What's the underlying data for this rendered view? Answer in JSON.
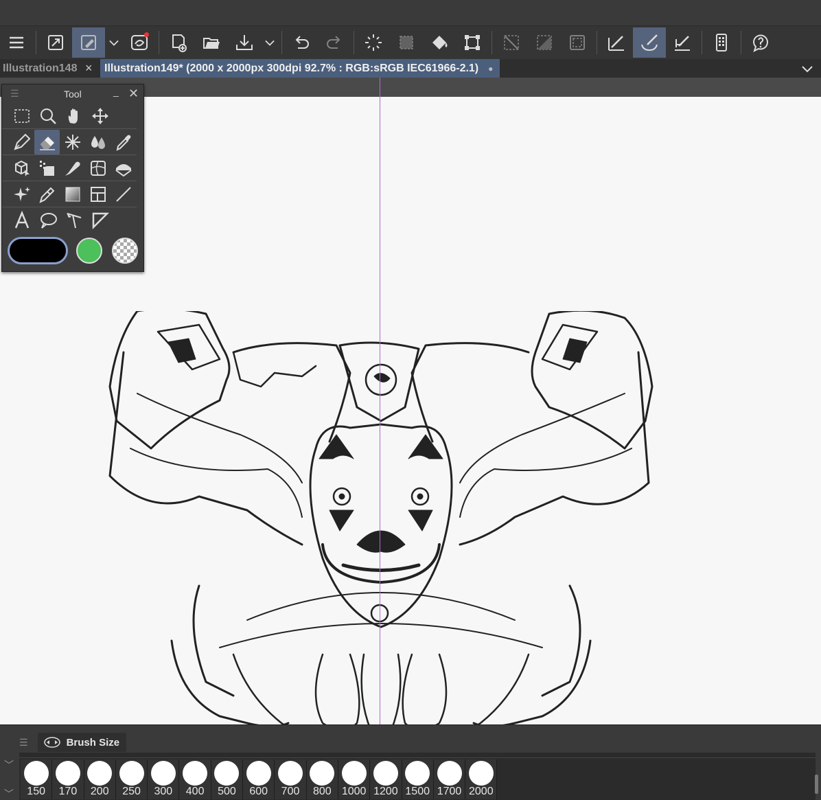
{
  "toolbar": {
    "items": [
      {
        "name": "menu-icon"
      },
      {
        "name": "fit-canvas-icon"
      },
      {
        "name": "quick-access-icon",
        "active": true
      },
      {
        "name": "dropdown-icon"
      },
      {
        "name": "companion-icon"
      },
      {
        "name": "new-file-icon"
      },
      {
        "name": "open-file-icon"
      },
      {
        "name": "save-icon"
      },
      {
        "name": "save-dropdown-icon"
      },
      {
        "name": "undo-icon"
      },
      {
        "name": "redo-icon"
      },
      {
        "name": "loading-icon"
      },
      {
        "name": "selection-launcher-icon"
      },
      {
        "name": "fill-icon"
      },
      {
        "name": "transform-icon"
      },
      {
        "name": "clear-selection-icon"
      },
      {
        "name": "invert-selection-icon"
      },
      {
        "name": "selection-border-icon"
      },
      {
        "name": "pen-icon"
      },
      {
        "name": "brush-icon",
        "active": true
      },
      {
        "name": "pencil-icon"
      },
      {
        "name": "smartphone-icon"
      },
      {
        "name": "help-icon"
      }
    ]
  },
  "tabs": [
    {
      "title": "Illustration148",
      "close": "×",
      "active": false
    },
    {
      "title": "Illustration149* (2000 x 2000px 300dpi 92.7% : RGB:sRGB IEC61966-2.1)",
      "mod": "●",
      "active": true
    }
  ],
  "tool_palette": {
    "title": "Tool",
    "minimize": "_",
    "close": "✕",
    "rows": [
      [
        "selection-tool",
        "zoom-tool",
        "hand-tool",
        "move-tool"
      ],
      [
        "pen-tool",
        "eraser-tool",
        "decoration-tool",
        "blend-tool",
        "eyedropper-tool"
      ],
      [
        "3d-operation-tool",
        "figure-tool",
        "airbrush-tool",
        "ruler-tool",
        "fill-tool"
      ],
      [
        "sparkle-tool",
        "brush-tool",
        "gradient-tool",
        "frame-border-tool",
        "line-tool"
      ],
      [
        "text-tool",
        "balloon-tool",
        "correct-line-tool",
        "figure-ruler-tool"
      ]
    ],
    "active_tool": "eraser-tool",
    "main_color": "#000000",
    "sub_color": "#4cc05a"
  },
  "brush_size": {
    "title": "Brush Size",
    "sizes": [
      "150",
      "170",
      "200",
      "250",
      "300",
      "400",
      "500",
      "600",
      "700",
      "800",
      "1000",
      "1200",
      "1500",
      "1700",
      "2000"
    ]
  }
}
